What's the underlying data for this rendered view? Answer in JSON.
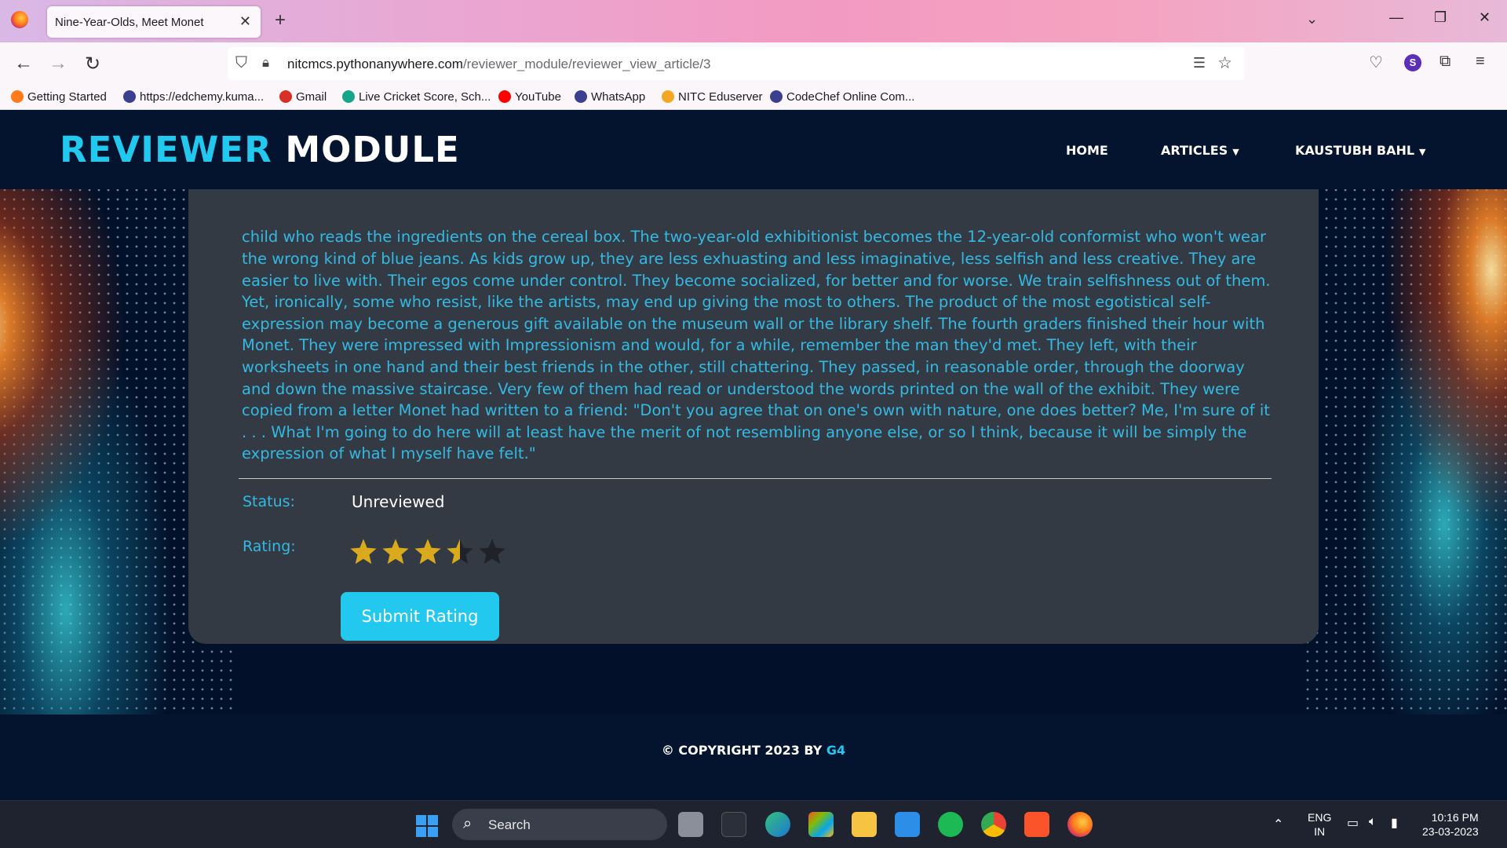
{
  "browser": {
    "tab_title": "Nine-Year-Olds, Meet Monet",
    "tab_close": "✕",
    "new_tab": "+",
    "url_host": "nitcmcs.pythonanywhere.com",
    "url_path": "/reviewer_module/reviewer_view_article/3",
    "bookmarks": [
      {
        "label": "Getting Started",
        "color": "#ff7a1a"
      },
      {
        "label": "https://edchemy.kuma...",
        "color": "#3b3f8f"
      },
      {
        "label": "Gmail",
        "color": "#d93025"
      },
      {
        "label": "Live Cricket Score, Sch...",
        "color": "#17a589"
      },
      {
        "label": "YouTube",
        "color": "#ff0000"
      },
      {
        "label": "WhatsApp",
        "color": "#3b3f8f"
      },
      {
        "label": "NITC Eduserver",
        "color": "#f5a623"
      },
      {
        "label": "CodeChef Online Com...",
        "color": "#3b3f8f"
      }
    ],
    "profile_initial": "S"
  },
  "site": {
    "brand_part1": "REVIEWER",
    "brand_part2": "MODULE",
    "nav": {
      "home": "HOME",
      "articles": "ARTICLES",
      "user": "KAUSTUBH BAHL"
    },
    "accent_color": "#22c8ee"
  },
  "article": {
    "body": "child who reads the ingredients on the cereal box. The two-year-old exhibitionist becomes the 12-year-old conformist who won't wear the wrong kind of blue jeans. As kids grow up, they are less exhuasting and less imaginative, less selfish and less creative. They are easier to live with. Their egos come under control. They become socialized, for better and for worse. We train selfishness out of them. Yet, ironically, some who resist, like the artists, may end up giving the most to others. The product of the most egotistical self-expression may become a generous gift available on the museum wall or the library shelf. The fourth graders finished their hour with Monet. They were impressed with Impressionism and would, for a while, remember the man they'd met. They left, with their worksheets in one hand and their best friends in the other, still chattering. They passed, in reasonable order, through the doorway and down the massive staircase. Very few of them had read or understood the words printed on the wall of the exhibit. They were copied from a letter Monet had written to a friend: \"Don't you agree that on one's own with nature, one does better? Me, I'm sure of it . . . What I'm going to do here will at least have the merit of not resembling anyone else, or so I think, because it will be simply the expression of what I myself have felt.\"",
    "status_label": "Status:",
    "status_value": "Unreviewed",
    "rating_label": "Rating:",
    "rating_value": 3.5,
    "rating_max": 5,
    "star_filled_color": "#d8aa1c",
    "star_empty_color": "#1f2228",
    "submit_label": "Submit Rating"
  },
  "footer": {
    "copyright_prefix": "© COPYRIGHT 2023 BY",
    "copyright_owner": "G4"
  },
  "taskbar": {
    "search_placeholder": "Search",
    "lang_line1": "ENG",
    "lang_line2": "IN",
    "time": "10:16 PM",
    "date": "23-03-2023"
  }
}
